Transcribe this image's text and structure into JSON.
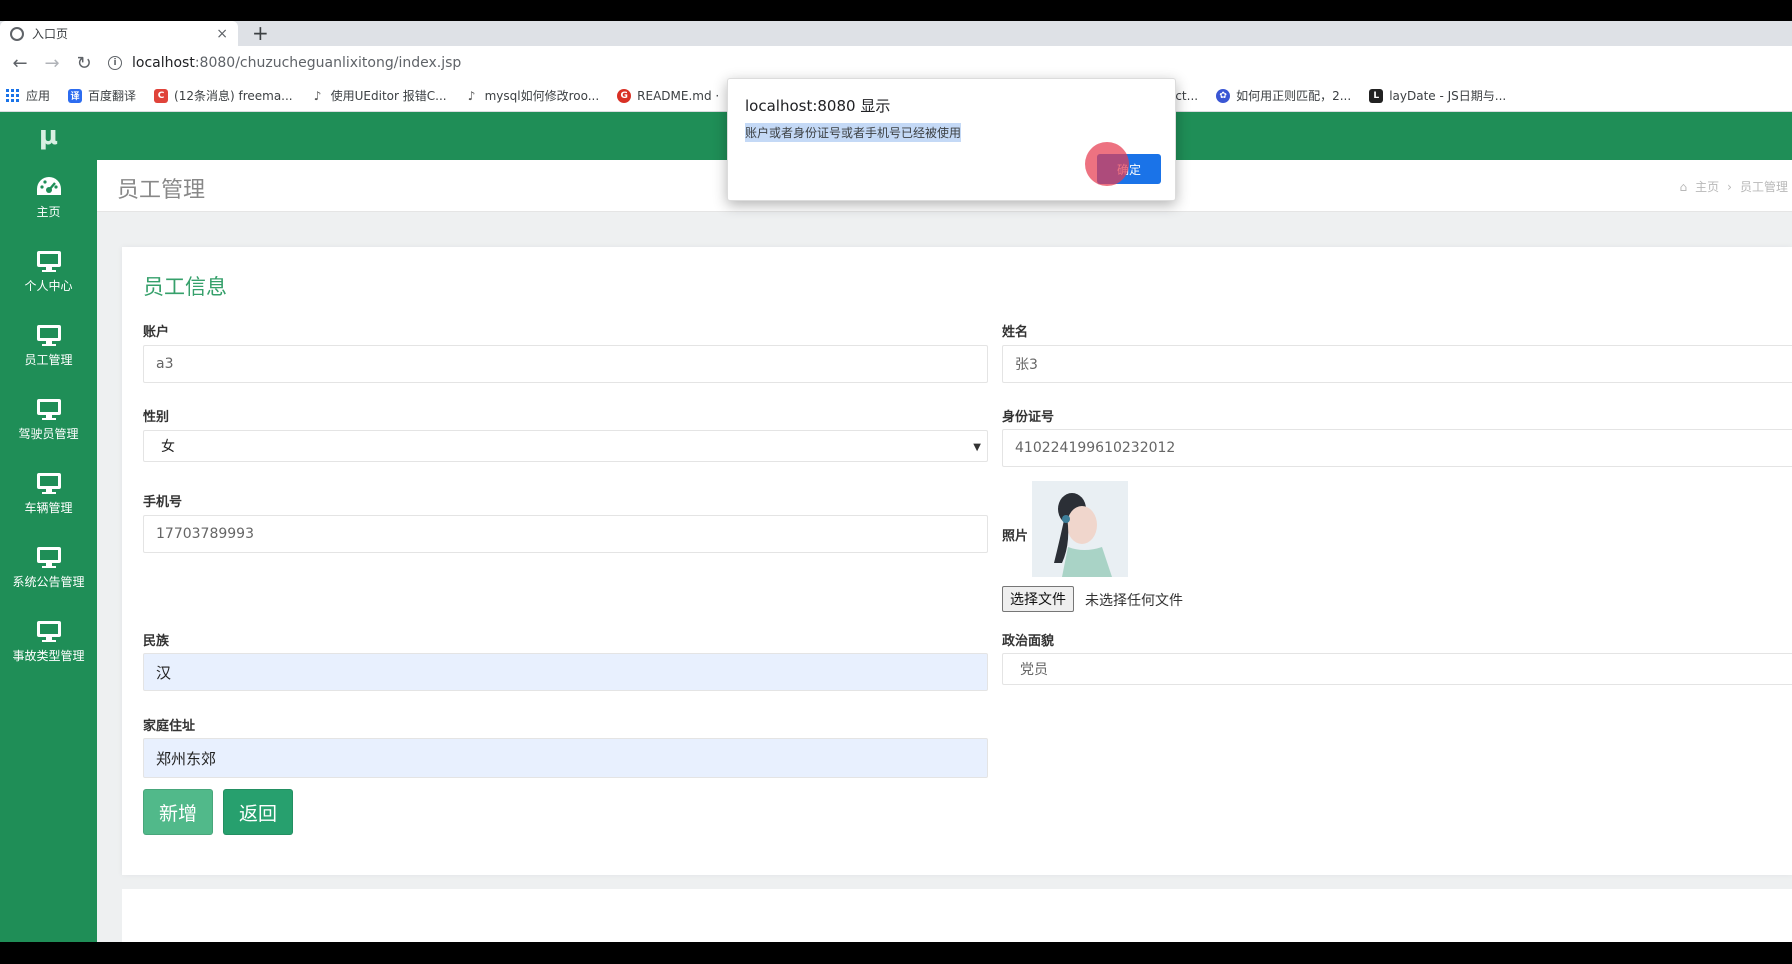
{
  "browser": {
    "tab_title": "入口页",
    "tab_close": "×",
    "new_tab": "+",
    "url_host": "localhost",
    "url_path": ":8080/chuzucheguanlixitong/index.jsp",
    "bookmarks": [
      {
        "label": "应用",
        "color": "#1a73e8"
      },
      {
        "label": "百度翻译",
        "color": "#2c6cf0"
      },
      {
        "label": "(12条消息) freema...",
        "color": "#e0433a"
      },
      {
        "label": "使用UEditor 报错C...",
        "color": "#555555"
      },
      {
        "label": "mysql如何修改roo...",
        "color": "#555555"
      },
      {
        "label": "README.md ·",
        "color": "#d93025"
      },
      {
        "label": "elect...",
        "color": "#555555"
      },
      {
        "label": "如何用正则匹配，2...",
        "color": "#3a56d4"
      },
      {
        "label": "layDate - JS日期与...",
        "color": "#222222"
      }
    ]
  },
  "sidebar": {
    "logo": "μ",
    "items": [
      {
        "label": "主页",
        "icon": "dashboard-icon"
      },
      {
        "label": "个人中心",
        "icon": "monitor-icon"
      },
      {
        "label": "员工管理",
        "icon": "monitor-icon"
      },
      {
        "label": "驾驶员管理",
        "icon": "monitor-icon"
      },
      {
        "label": "车辆管理",
        "icon": "monitor-icon"
      },
      {
        "label": "系统公告管理",
        "icon": "monitor-icon"
      },
      {
        "label": "事故类型管理",
        "icon": "monitor-icon"
      }
    ]
  },
  "header": {
    "page_title": "员工管理",
    "breadcrumb_home": "主页",
    "breadcrumb_sep": "›",
    "breadcrumb_current": "员工管理"
  },
  "form": {
    "title": "员工信息",
    "account_label": "账户",
    "account_value": "a3",
    "name_label": "姓名",
    "name_value": "张3",
    "gender_label": "性别",
    "gender_value": "女",
    "idcard_label": "身份证号",
    "idcard_value": "410224199610232012",
    "phone_label": "手机号",
    "phone_value": "17703789993",
    "photo_label": "照片",
    "file_button": "选择文件",
    "file_status": "未选择任何文件",
    "ethnicity_label": "民族",
    "ethnicity_value": "汉",
    "political_label": "政治面貌",
    "political_value": "党员",
    "address_label": "家庭住址",
    "address_value": "郑州东郊",
    "add_button": "新增",
    "back_button": "返回"
  },
  "dialog": {
    "title": "localhost:8080 显示",
    "message": "账户或者身份证号或者手机号已经被使用",
    "ok_button": "确定"
  },
  "colors": {
    "sidebar": "#1f8e57",
    "accent": "#36a06b",
    "dialog_button": "#1a73e8"
  }
}
